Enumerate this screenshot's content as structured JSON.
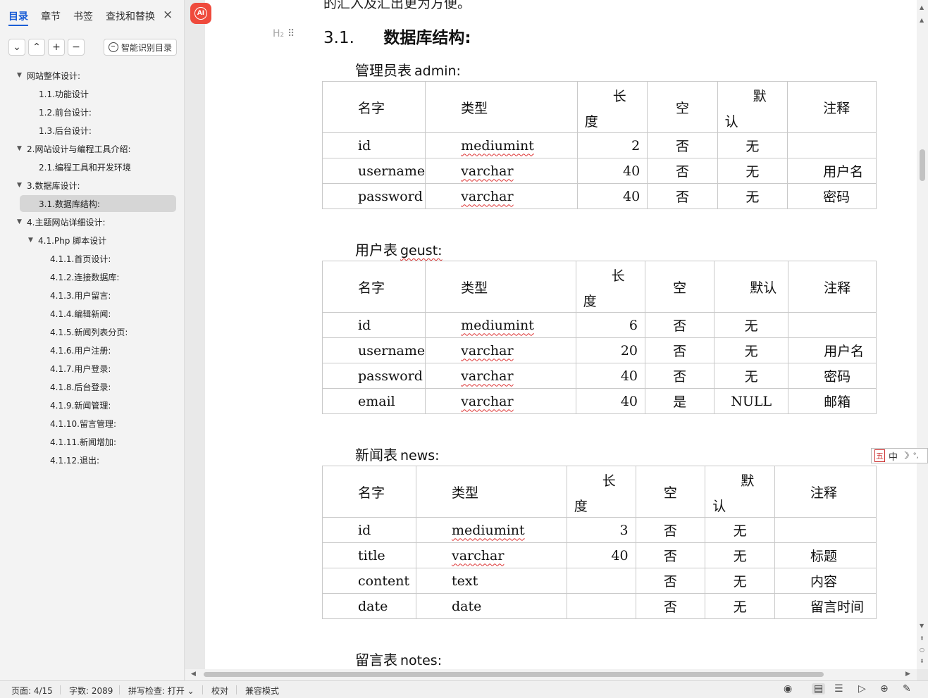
{
  "sidebar": {
    "tabs": [
      "目录",
      "章节",
      "书签",
      "查找和替换"
    ],
    "close": "×",
    "toolbar": {
      "collapse": "⌄",
      "up": "⌃",
      "add": "+",
      "remove": "−",
      "smart_toc": "智能识别目录"
    },
    "toc": [
      {
        "label": "网站整体设计:",
        "level": 0,
        "expanded": true
      },
      {
        "label": "1.1.功能设计",
        "level": 1
      },
      {
        "label": "1.2.前台设计:",
        "level": 1
      },
      {
        "label": "1.3.后台设计:",
        "level": 1
      },
      {
        "label": "2.网站设计与编程工具介绍:",
        "level": 0,
        "expanded": true
      },
      {
        "label": "2.1.编程工具和开发环境",
        "level": 1
      },
      {
        "label": "3.数据库设计:",
        "level": 0,
        "expanded": true
      },
      {
        "label": "3.1.数据库结构:",
        "level": 1,
        "selected": true
      },
      {
        "label": "4.主题网站详细设计:",
        "level": 0,
        "expanded": true
      },
      {
        "label": "4.1.Php 脚本设计",
        "level": 1,
        "expanded": true
      },
      {
        "label": "4.1.1.首页设计:",
        "level": 2
      },
      {
        "label": "4.1.2.连接数据库:",
        "level": 2
      },
      {
        "label": "4.1.3.用户留言:",
        "level": 2
      },
      {
        "label": "4.1.4.编辑新闻:",
        "level": 2
      },
      {
        "label": "4.1.5.新闻列表分页:",
        "level": 2
      },
      {
        "label": "4.1.6.用户注册:",
        "level": 2
      },
      {
        "label": "4.1.7.用户登录:",
        "level": 2
      },
      {
        "label": "4.1.8.后台登录:",
        "level": 2
      },
      {
        "label": "4.1.9.新闻管理:",
        "level": 2
      },
      {
        "label": "4.1.10.留言管理:",
        "level": 2
      },
      {
        "label": "4.1.11.新闻增加:",
        "level": 2
      },
      {
        "label": "4.1.12.退出:",
        "level": 2
      }
    ]
  },
  "document": {
    "top_cut_text": "的汇入及汇出更为方便。",
    "h2_marker": "H₂",
    "heading_num": "3.1.",
    "heading_text": "数据库结构:",
    "headers": {
      "name": "名字",
      "type": "类型",
      "len_a": "长",
      "len_b": "度",
      "null": "空",
      "def_a": "默",
      "def_b": "认",
      "def_full": "默认",
      "note": "注释"
    },
    "tables": [
      {
        "label": "管理员表",
        "name": "admin:",
        "rows": [
          [
            "id",
            "mediumint",
            "2",
            "否",
            "无",
            ""
          ],
          [
            "username",
            "varchar",
            "40",
            "否",
            "无",
            "用户名"
          ],
          [
            "password",
            "varchar",
            "40",
            "否",
            "无",
            "密码"
          ]
        ]
      },
      {
        "label": "用户表",
        "name": "geust:",
        "rows": [
          [
            "id",
            "mediumint",
            "6",
            "否",
            "无",
            ""
          ],
          [
            "username",
            "varchar",
            "20",
            "否",
            "无",
            "用户名"
          ],
          [
            "password",
            "varchar",
            "40",
            "否",
            "无",
            "密码"
          ],
          [
            "email",
            "varchar",
            "40",
            "是",
            "NULL",
            "邮箱"
          ]
        ]
      },
      {
        "label": "新闻表",
        "name": "news:",
        "rows": [
          [
            "id",
            "mediumint",
            "3",
            "否",
            "无",
            ""
          ],
          [
            "title",
            "varchar",
            "40",
            "否",
            "无",
            "标题"
          ],
          [
            "content",
            "text",
            "",
            "否",
            "无",
            "内容"
          ],
          [
            "date",
            "date",
            "",
            "否",
            "无",
            "留言时间"
          ]
        ]
      },
      {
        "label": "留言表",
        "name": "notes:"
      }
    ]
  },
  "ime": {
    "wu": "五",
    "mode": "中",
    "moon": "☽",
    "punct": "°,"
  },
  "status": {
    "page": "页面: 4/15",
    "words": "字数: 2089",
    "spell": "拼写检查: 打开 ⌄",
    "proof": "校对",
    "compat": "兼容模式"
  },
  "icons": {
    "ai": "AI",
    "eye": "eye-icon",
    "page_view": "page-view-icon",
    "outline": "outline-icon",
    "play": "play-icon",
    "web": "globe-icon",
    "pen": "pen-icon"
  },
  "colors": {
    "accent": "#1a5ed6",
    "ai_badge": "#ef4a3c"
  }
}
